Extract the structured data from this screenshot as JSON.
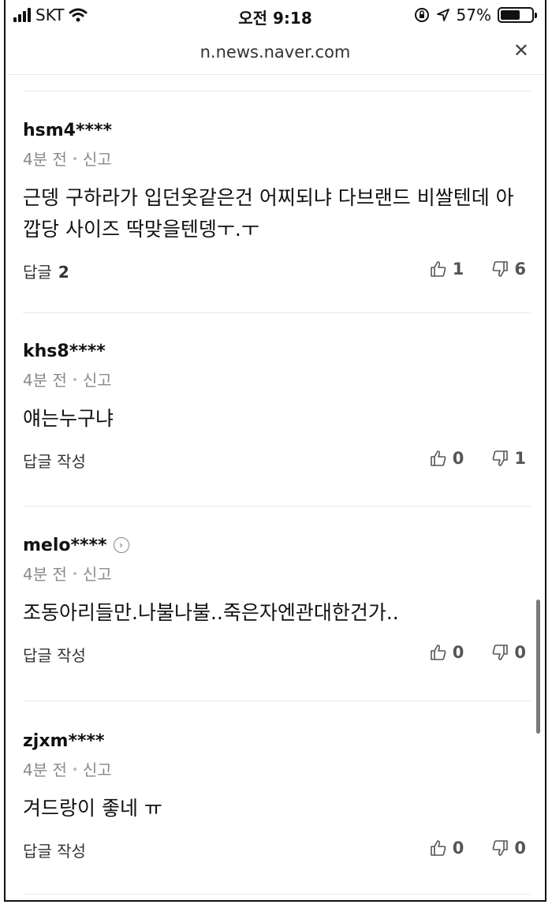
{
  "status_bar": {
    "carrier": "SKT",
    "time": "오전 9:18",
    "battery_percent": "57%",
    "battery_level": 0.57
  },
  "browser": {
    "url": "n.news.naver.com",
    "close_icon": "✕"
  },
  "comments": [
    {
      "user": "hsm4****",
      "time": "4분 전",
      "report": "신고",
      "text": "근뎅 구하라가 입던옷같은건 어찌되냐 다브랜드 비쌀텐데 아깝당 사이즈 딱맞을텐뎅ㅜ.ㅜ",
      "reply_label": "답글",
      "reply_count": "2",
      "likes": "1",
      "dislikes": "6"
    },
    {
      "user": "khs8****",
      "time": "4분 전",
      "report": "신고",
      "text": "얘는누구냐",
      "reply_label": "답글 작성",
      "likes": "0",
      "dislikes": "1"
    },
    {
      "user": "melo****",
      "time": "4분 전",
      "report": "신고",
      "text": "조동아리들만.나불나불..죽은자엔관대한건가..",
      "reply_label": "답글 작성",
      "likes": "0",
      "dislikes": "0"
    },
    {
      "user": "zjxm****",
      "time": "4분 전",
      "report": "신고",
      "text": "겨드랑이 좋네 ㅠ",
      "reply_label": "답글 작성",
      "likes": "0",
      "dislikes": "0"
    }
  ]
}
